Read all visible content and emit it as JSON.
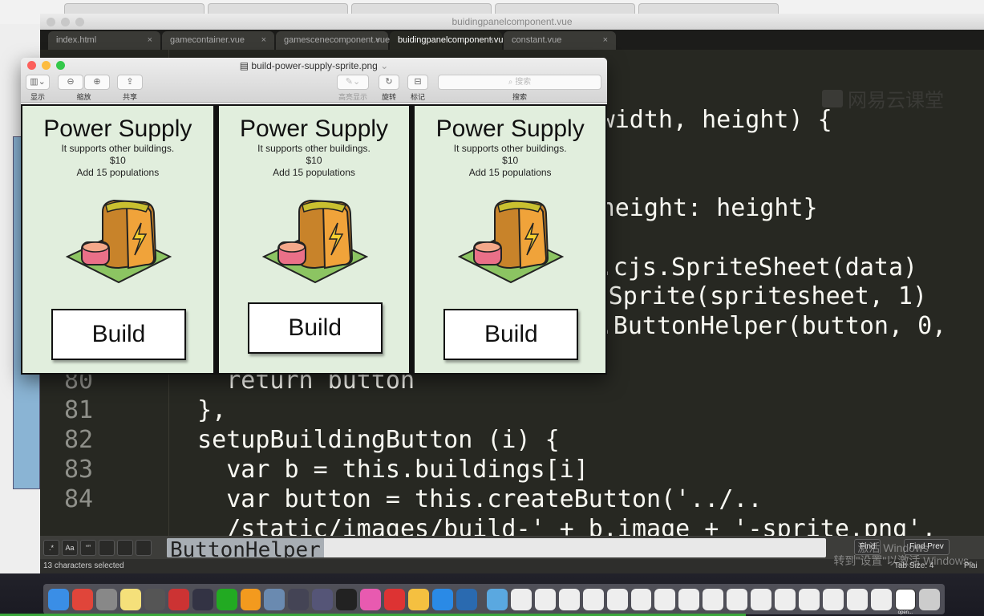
{
  "browser": {
    "tabs": [
      "",
      "",
      "",
      "",
      ""
    ]
  },
  "editor": {
    "title": "buidingpanelcomponent.vue",
    "tabs": [
      {
        "label": "index.html",
        "active": false
      },
      {
        "label": "gamecontainer.vue",
        "active": false
      },
      {
        "label": "gamescenecomponent.vue",
        "active": false
      },
      {
        "label": "buidingpanelcomponent.vue",
        "active": true
      },
      {
        "label": "constant.vue",
        "active": false
      }
    ],
    "watermark": "网易云课堂",
    "partial_lines": [
      "width, height) {",
      "height: height}",
      "s.cjs.SpriteSheet(data)",
      "Sprite(spritesheet, 1)",
      "s.ButtonHelper(button, 0,"
    ],
    "lines": [
      {
        "n": "80",
        "text": "    return button"
      },
      {
        "n": "81",
        "text": "  },"
      },
      {
        "n": "82",
        "text": "  setupBuildingButton (i) {"
      },
      {
        "n": "83",
        "text": "    var b = this.buildings[i]"
      },
      {
        "n": "84",
        "text": "    var button = this.createButton('../.."
      },
      {
        "n": "",
        "text": "    /static/images/build-' + b.image + '-sprite.png',"
      }
    ],
    "find": {
      "options": [
        ".*",
        "Aa",
        "“”",
        "",
        "",
        ""
      ],
      "value": "ButtonHelper",
      "find_label": "Find",
      "find_prev_label": "Find Prev"
    },
    "status": {
      "selection": "13 characters selected",
      "tab_size": "Tab Size: 4",
      "syntax": "Plai"
    },
    "activation_overlay": [
      "激活 Windows",
      "转到\"设置\"以激活 Windows。"
    ]
  },
  "preview": {
    "title": "build-power-supply-sprite.png",
    "toolbar": {
      "view": "显示",
      "zoom": "缩放",
      "share": "共享",
      "highlight": "高亮显示",
      "rotate": "旋转",
      "markup": "标记",
      "search_placeholder": "搜索",
      "search_label": "搜索"
    },
    "cards": [
      {
        "title": "Power Supply",
        "desc": "It supports other buildings.",
        "price": "$10",
        "effect": "Add 15 populations",
        "button": "Build"
      },
      {
        "title": "Power Supply",
        "desc": "It supports other buildings.",
        "price": "$10",
        "effect": "Add 15 populations",
        "button": "Build"
      },
      {
        "title": "Power Supply",
        "desc": "It supports other buildings.",
        "price": "$10",
        "effect": "Add 15 populations",
        "button": "Build"
      }
    ]
  },
  "dock": {
    "apps": [
      "finder",
      "chrome",
      "launchpad",
      "notes",
      "sublime",
      "dvd",
      "eclipse",
      "sync",
      "ibooks",
      "preview",
      "screen",
      "virtualbox",
      "terminal",
      "itunes",
      "parallels",
      "files",
      "safari",
      "quicktime",
      "folder",
      "windows",
      "windows",
      "windows",
      "windows",
      "windows",
      "windows",
      "windows",
      "windows",
      "windows",
      "windows",
      "windows",
      "windows",
      "windows",
      "windows",
      "windows",
      "windows",
      "windows",
      "trash"
    ],
    "last_label": "open..."
  },
  "colors": {
    "editor_bg": "#272822",
    "card_bg": "#e1eedd",
    "accent_green": "#3aa63a"
  }
}
